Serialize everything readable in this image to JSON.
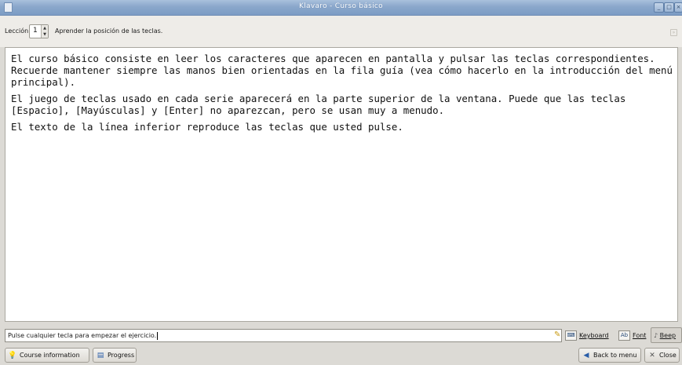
{
  "window": {
    "title": "Klavaro - Curso básico",
    "buttons": [
      "minimize",
      "maximize",
      "close"
    ]
  },
  "lesson": {
    "label": "Lección:",
    "number": "1",
    "description": "Aprender la posición de las teclas."
  },
  "instructions": {
    "paragraphs": [
      "El curso básico consiste en leer los caracteres que aparecen en pantalla y pulsar las teclas correspondientes. Recuerde mantener siempre las manos bien orientadas en la fila guía (vea cómo hacerlo en la introducción del menú principal).",
      "El juego de teclas usado en cada serie aparecerá en la parte superior de la ventana. Puede que las teclas [Espacio], [Mayúsculas] y [Enter] no aparezcan, pero se usan muy a menudo.",
      "El texto de la línea inferior reproduce las teclas que usted pulse."
    ]
  },
  "entry": {
    "value": "Pulse cualquier tecla para empezar el ejercicio."
  },
  "tools": {
    "keyboard_label": "Keyboard",
    "font_label": "Font",
    "beep_label": "Beep"
  },
  "bottom": {
    "course_info_label": "Course information",
    "progress_label": "Progress",
    "back_label": "Back to menu",
    "close_label": "Close"
  }
}
